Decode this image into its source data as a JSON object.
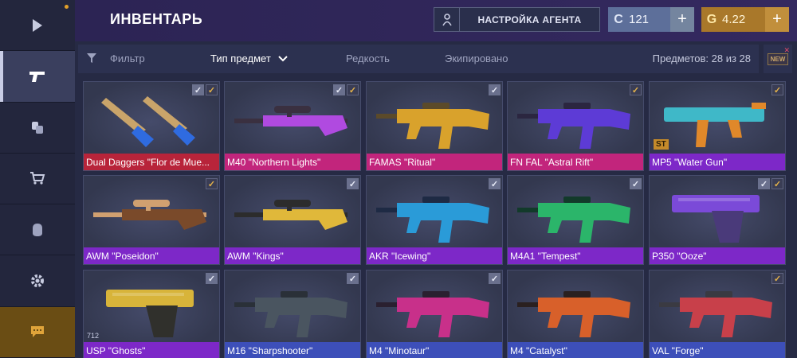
{
  "header": {
    "title": "ИНВЕНТАРЬ",
    "agent_button": "НАСТРОЙКА АГЕНТА",
    "silver": "121",
    "gold": "4.22",
    "plus": "+"
  },
  "filterbar": {
    "filter": "Фильтр",
    "type": "Тип предмет",
    "rarity": "Редкость",
    "equipped": "Экипировано",
    "count": "Предметов: 28 из 28",
    "new_badge": "NEW"
  },
  "sidebar": {
    "items": [
      "play-icon",
      "pistol-icon",
      "coins-icon",
      "cart-icon",
      "hand-icon",
      "gear-icon",
      "chat-icon"
    ]
  },
  "colors": {
    "red": "#b8243a",
    "pink": "#c2257c",
    "purple": "#7d28c8",
    "blue": "#3d4fb9"
  },
  "items": [
    {
      "name": "Dual Daggers \"Flor de Mue...",
      "rarity": "red",
      "checks": "both",
      "icon": "dual-daggers-icon"
    },
    {
      "name": "M40 \"Northern Lights\"",
      "rarity": "pink",
      "checks": "both",
      "icon": "sniper-rifle-icon"
    },
    {
      "name": "FAMAS \"Ritual\"",
      "rarity": "pink",
      "checks": "gray",
      "icon": "rifle-icon"
    },
    {
      "name": "FN FAL \"Astral Rift\"",
      "rarity": "pink",
      "checks": "gold",
      "icon": "rifle-icon"
    },
    {
      "name": "MP5 \"Water Gun\"",
      "rarity": "purple",
      "checks": "gold",
      "icon": "smg-icon",
      "tag": "ST"
    },
    {
      "name": "AWM \"Poseidon\"",
      "rarity": "purple",
      "checks": "gold",
      "icon": "sniper-rifle-icon"
    },
    {
      "name": "AWM \"Kings\"",
      "rarity": "purple",
      "checks": "gray",
      "icon": "sniper-rifle-icon"
    },
    {
      "name": "AKR \"Icewing\"",
      "rarity": "purple",
      "checks": "gray",
      "icon": "rifle-icon"
    },
    {
      "name": "M4A1 \"Tempest\"",
      "rarity": "purple",
      "checks": "gray",
      "icon": "rifle-icon"
    },
    {
      "name": "P350 \"Ooze\"",
      "rarity": "purple",
      "checks": "both",
      "icon": "pistol-icon"
    },
    {
      "name": "USP \"Ghosts\"",
      "rarity": "purple",
      "checks": "gray",
      "icon": "pistol-icon",
      "count": "712"
    },
    {
      "name": "M16 \"Sharpshooter\"",
      "rarity": "blue",
      "checks": "gray",
      "icon": "rifle-icon"
    },
    {
      "name": "M4 \"Minotaur\"",
      "rarity": "blue",
      "checks": "gray",
      "icon": "rifle-icon"
    },
    {
      "name": "M4 \"Catalyst\"",
      "rarity": "blue",
      "checks": "none",
      "icon": "rifle-icon"
    },
    {
      "name": "VAL \"Forge\"",
      "rarity": "blue",
      "checks": "gold",
      "icon": "rifle-icon"
    }
  ]
}
